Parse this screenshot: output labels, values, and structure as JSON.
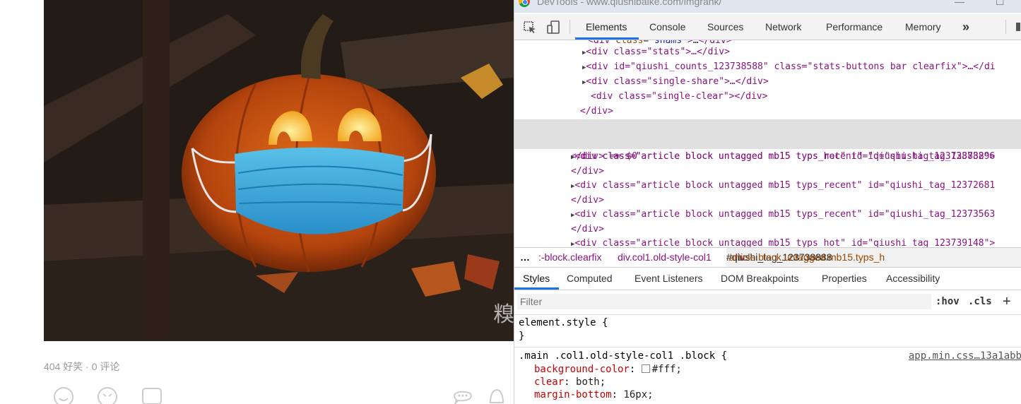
{
  "post": {
    "watermark": "糗",
    "stats": "404 好笑 · 0 评论"
  },
  "devtools": {
    "window_title": "DevTools - www.qiushibaike.com/imgrank/",
    "tabs": [
      "Elements",
      "Console",
      "Sources",
      "Network",
      "Performance",
      "Memory"
    ],
    "more_tabs": "»",
    "dom_lines": [
      {
        "t": "<div class=\"stats\">…</div>"
      },
      {
        "t": "<div id=\"qiushi_counts_123738588\" class=\"stats-buttons bar clearfix\">…</di"
      },
      {
        "t": "<div class=\"single-share\">…</div>"
      },
      {
        "t": "<div class=\"single-clear\"></div>"
      },
      {
        "t": "</div>"
      },
      {
        "t": "<div class=\"article block untagged mb15 typs_hot\" id=\"qiushi_tag_123738888\">"
      },
      {
        "t": "</div> == $0"
      },
      {
        "t": "<div class=\"article block untagged mb15 typs_recent\" id=\"qiushi_tag_12373296"
      },
      {
        "t": "</div>"
      },
      {
        "t": "<div class=\"article block untagged mb15 typs_recent\" id=\"qiushi_tag_12372681"
      },
      {
        "t": "</div>"
      },
      {
        "t": "<div class=\"article block untagged mb15 typs_recent\" id=\"qiushi_tag_12373563"
      },
      {
        "t": "</div>"
      },
      {
        "t": "<div class=\"article block untagged mb15 typs_hot\" id=\"qiushi_tag_123739148\">"
      }
    ],
    "row_menu": "···",
    "breadcrumbs": {
      "ellipsis": "…",
      "c1": ":-block.clearfix",
      "c2": "div.col1.old-style-col1",
      "c3_tag": "div",
      "c3_id": "#qiushi_tag_123738888",
      "c3_cls": ".article.block.untagged.mb15.typs_h"
    },
    "subtabs": [
      "Styles",
      "Computed",
      "Event Listeners",
      "DOM Breakpoints",
      "Properties",
      "Accessibility"
    ],
    "filter_placeholder": "Filter",
    "hov": ":hov",
    "cls": ".cls",
    "plus": "+",
    "element_style_open": "element.style {",
    "close_brace": "}",
    "rule_selector": ".main .col1.old-style-col1 .block {",
    "rule_source": "app.min.css…13a1abb",
    "declarations": [
      {
        "prop": "background-color",
        "val": "#fff;"
      },
      {
        "prop": "clear",
        "val": "both;"
      },
      {
        "prop": "margin-bottom",
        "val": "16px;"
      }
    ],
    "colors": {
      "accent": "#1a73e8",
      "tag": "#881280",
      "attr": "#994500",
      "value": "#1a1aa6"
    }
  }
}
